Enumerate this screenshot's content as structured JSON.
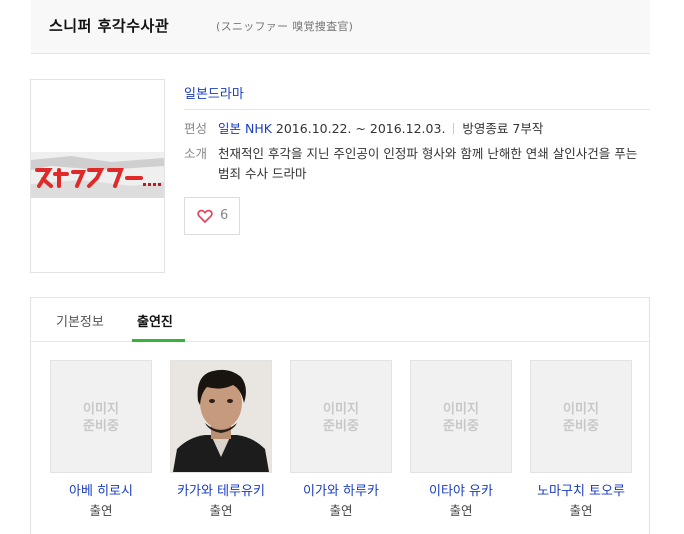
{
  "header": {
    "title": "스니퍼 후각수사관",
    "original_title": "(スニッファー 嗅覚捜査官)"
  },
  "info": {
    "genre": "일본드라마",
    "publish_label": "편성",
    "publish_channel": "일본 NHK",
    "publish_period": "2016.10.22. ~ 2016.12.03.",
    "status": "방영종료 7부작",
    "intro_label": "소개",
    "intro_text": "천재적인 후각을 지닌 주인공이 인정파 형사와 함께 난해한 연쇄 살인사건을 푸는 범죄 수사 드라마"
  },
  "like": {
    "count": "6"
  },
  "tabs": {
    "basic": "기본정보",
    "cast": "출연진"
  },
  "no_image": {
    "line1": "이미지",
    "line2": "준비중"
  },
  "cast": [
    {
      "name": "아베 히로시",
      "role": "출연",
      "has_photo": false
    },
    {
      "name": "카가와 테루유키",
      "role": "출연",
      "has_photo": true
    },
    {
      "name": "이가와 하루카",
      "role": "출연",
      "has_photo": false
    },
    {
      "name": "이타야 유카",
      "role": "출연",
      "has_photo": false
    },
    {
      "name": "노마구치 토오루",
      "role": "출연",
      "has_photo": false
    }
  ],
  "colors": {
    "link": "#1a3dc1",
    "accent": "#35b43a",
    "poster_red": "#e02a2a"
  }
}
